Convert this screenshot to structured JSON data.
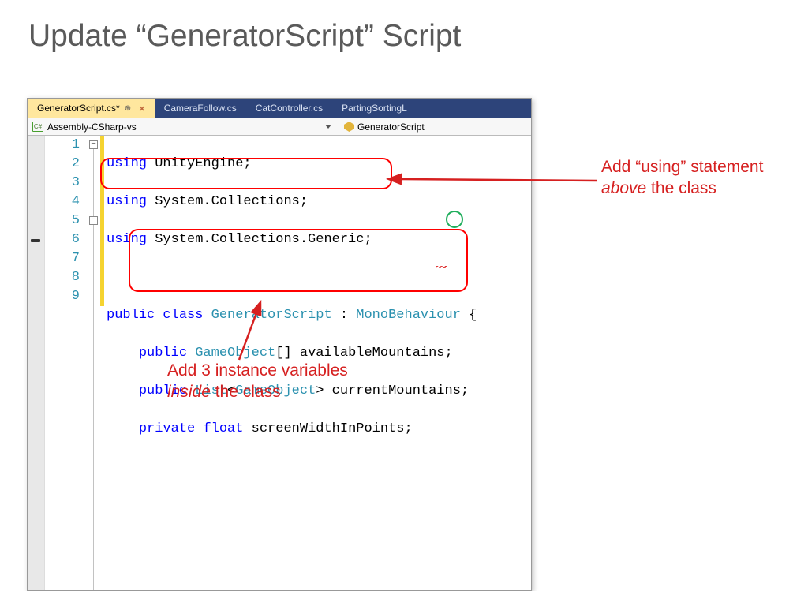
{
  "title": "Update “GeneratorScript” Script",
  "tabs": {
    "active": "GeneratorScript.cs*",
    "t1": "CameraFollow.cs",
    "t2": "CatController.cs",
    "t3": "PartingSortingL"
  },
  "dropdown": {
    "assembly": "Assembly-CSharp-vs",
    "classname": "GeneratorScript"
  },
  "lineNumbers": [
    "1",
    "2",
    "3",
    "4",
    "5",
    "6",
    "7",
    "8",
    "9"
  ],
  "code": {
    "l1": {
      "a": "using",
      "b": " UnityEngine;"
    },
    "l2": {
      "a": "using",
      "b": " System.Collections;"
    },
    "l3": {
      "a": "using",
      "b": " System.Collections.Generic;"
    },
    "l4": "",
    "l5": {
      "a": "public",
      "b": "class",
      "c": "GeneratorScript",
      "d": " : ",
      "e": "MonoBehaviour",
      "f": " {"
    },
    "l6": {
      "a": "public",
      "b": "GameObject",
      "c": "[] availableMountains;"
    },
    "l7": {
      "a": "public",
      "b": "List",
      "c": "<",
      "d": "GameObject",
      "e": "> currentMountains;"
    },
    "l8": {
      "a": "private",
      "b": "float",
      "c": " screenWidthInPoints;"
    },
    "l9": ""
  },
  "annotations": {
    "top": {
      "line1": "Add “using” statement",
      "line2_em": "above",
      "line2_rest": " the class"
    },
    "bottom": {
      "line1": "Add 3 instance variables",
      "line2_em": "inside",
      "line2_rest": " the class"
    }
  }
}
